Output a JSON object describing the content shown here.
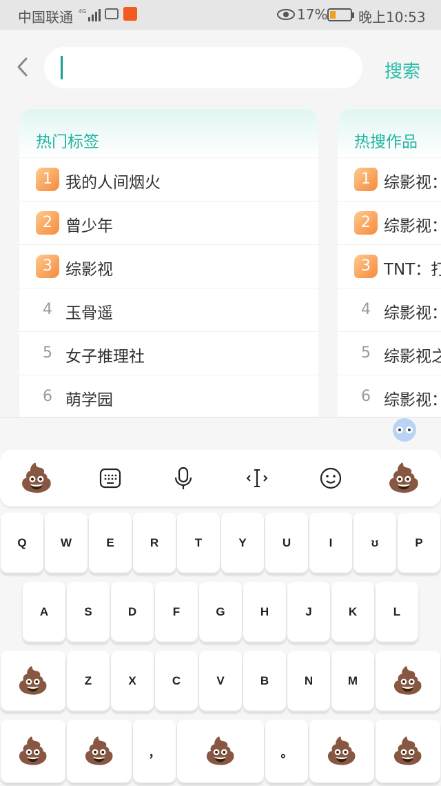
{
  "status_bar": {
    "carrier": "中国联通",
    "battery": "17%",
    "time": "晚上10:53"
  },
  "search": {
    "value": "",
    "button_label": "搜索"
  },
  "cards": [
    {
      "title": "热门标签",
      "items": [
        {
          "rank": "1",
          "text": "我的人间烟火"
        },
        {
          "rank": "2",
          "text": "曾少年"
        },
        {
          "rank": "3",
          "text": "综影视"
        },
        {
          "rank": "4",
          "text": "玉骨遥"
        },
        {
          "rank": "5",
          "text": "女子推理社"
        },
        {
          "rank": "6",
          "text": "萌学园"
        }
      ]
    },
    {
      "title": "热搜作品",
      "items": [
        {
          "rank": "1",
          "text": "综影视："
        },
        {
          "rank": "2",
          "text": "综影视："
        },
        {
          "rank": "3",
          "text": "TNT：打"
        },
        {
          "rank": "4",
          "text": "综影视："
        },
        {
          "rank": "5",
          "text": "综影视之"
        },
        {
          "rank": "6",
          "text": "综影视："
        }
      ]
    }
  ],
  "keyboard": {
    "toolbar": [
      "💩",
      "keyboard-icon",
      "microphone-icon",
      "cursor-icon",
      "emoji-face-icon",
      "💩"
    ],
    "rows": [
      [
        "Q",
        "W",
        "E",
        "R",
        "T",
        "Y",
        "U",
        "I",
        "ʊ",
        "P"
      ],
      [
        "A",
        "S",
        "D",
        "F",
        "G",
        "H",
        "J",
        "K",
        "L"
      ],
      [
        "💩",
        "Z",
        "X",
        "C",
        "V",
        "B",
        "N",
        "M",
        "💩"
      ],
      [
        "💩",
        "💩",
        "，",
        "💩",
        "。",
        "💩",
        "💩"
      ]
    ]
  },
  "colors": {
    "accent": "#2bbfad",
    "rank_top_start": "#ffc98e",
    "rank_top_end": "#f58a3c"
  }
}
